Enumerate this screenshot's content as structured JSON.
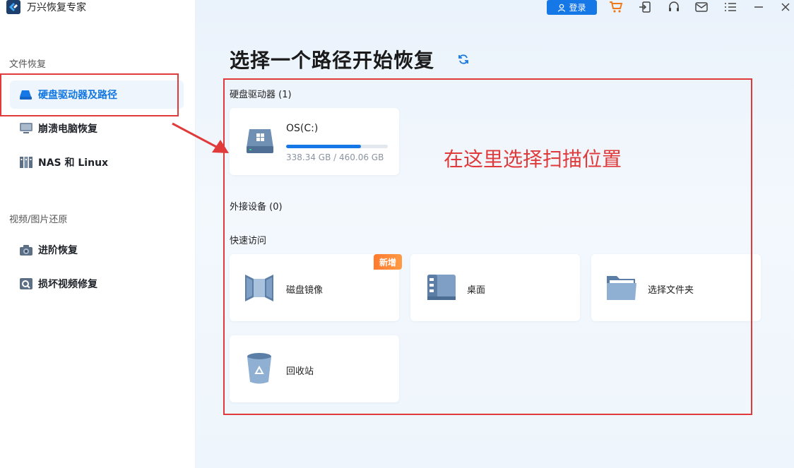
{
  "app": {
    "name": "万兴恢复专家"
  },
  "sidebar": {
    "section_file_recovery": "文件恢复",
    "section_media_restore": "视频/图片还原",
    "items": [
      {
        "label": "硬盘驱动器及路径",
        "icon": "disk-drive-icon",
        "active": true
      },
      {
        "label": "崩溃电脑恢复",
        "icon": "monitor-icon",
        "active": false
      },
      {
        "label": "NAS 和 Linux",
        "icon": "nas-icon",
        "active": false
      },
      {
        "label": "进阶恢复",
        "icon": "camera-icon",
        "active": false
      },
      {
        "label": "损坏视频修复",
        "icon": "video-repair-icon",
        "active": false
      }
    ]
  },
  "toolbar": {
    "login_label": "登录",
    "icons": [
      "cart-icon",
      "import-icon",
      "headset-icon",
      "mail-icon",
      "menu-icon",
      "minimize-icon",
      "close-icon"
    ]
  },
  "main": {
    "title": "选择一个路径开始恢复",
    "hard_drives": {
      "title": "硬盘驱动器",
      "count": "(1)",
      "drives": [
        {
          "name": "OS(C:)",
          "used_text": "338.34 GB / 460.06 GB",
          "usage_fraction": 0.7355
        }
      ]
    },
    "external": {
      "title": "外接设备",
      "count": "(0)"
    },
    "quick_access": {
      "title": "快速访问",
      "items": [
        {
          "label": "磁盘镜像",
          "icon": "disk-image-icon",
          "badge": "新增"
        },
        {
          "label": "桌面",
          "icon": "desktop-icon"
        },
        {
          "label": "选择文件夹",
          "icon": "folder-icon"
        },
        {
          "label": "回收站",
          "icon": "recycle-bin-icon"
        }
      ]
    }
  },
  "annotation": {
    "text": "在这里选择扫描位置",
    "color": "#e03a3a"
  },
  "colors": {
    "accent": "#1677e6",
    "annotation": "#e03a3a",
    "badge": "#ff7a2e"
  }
}
